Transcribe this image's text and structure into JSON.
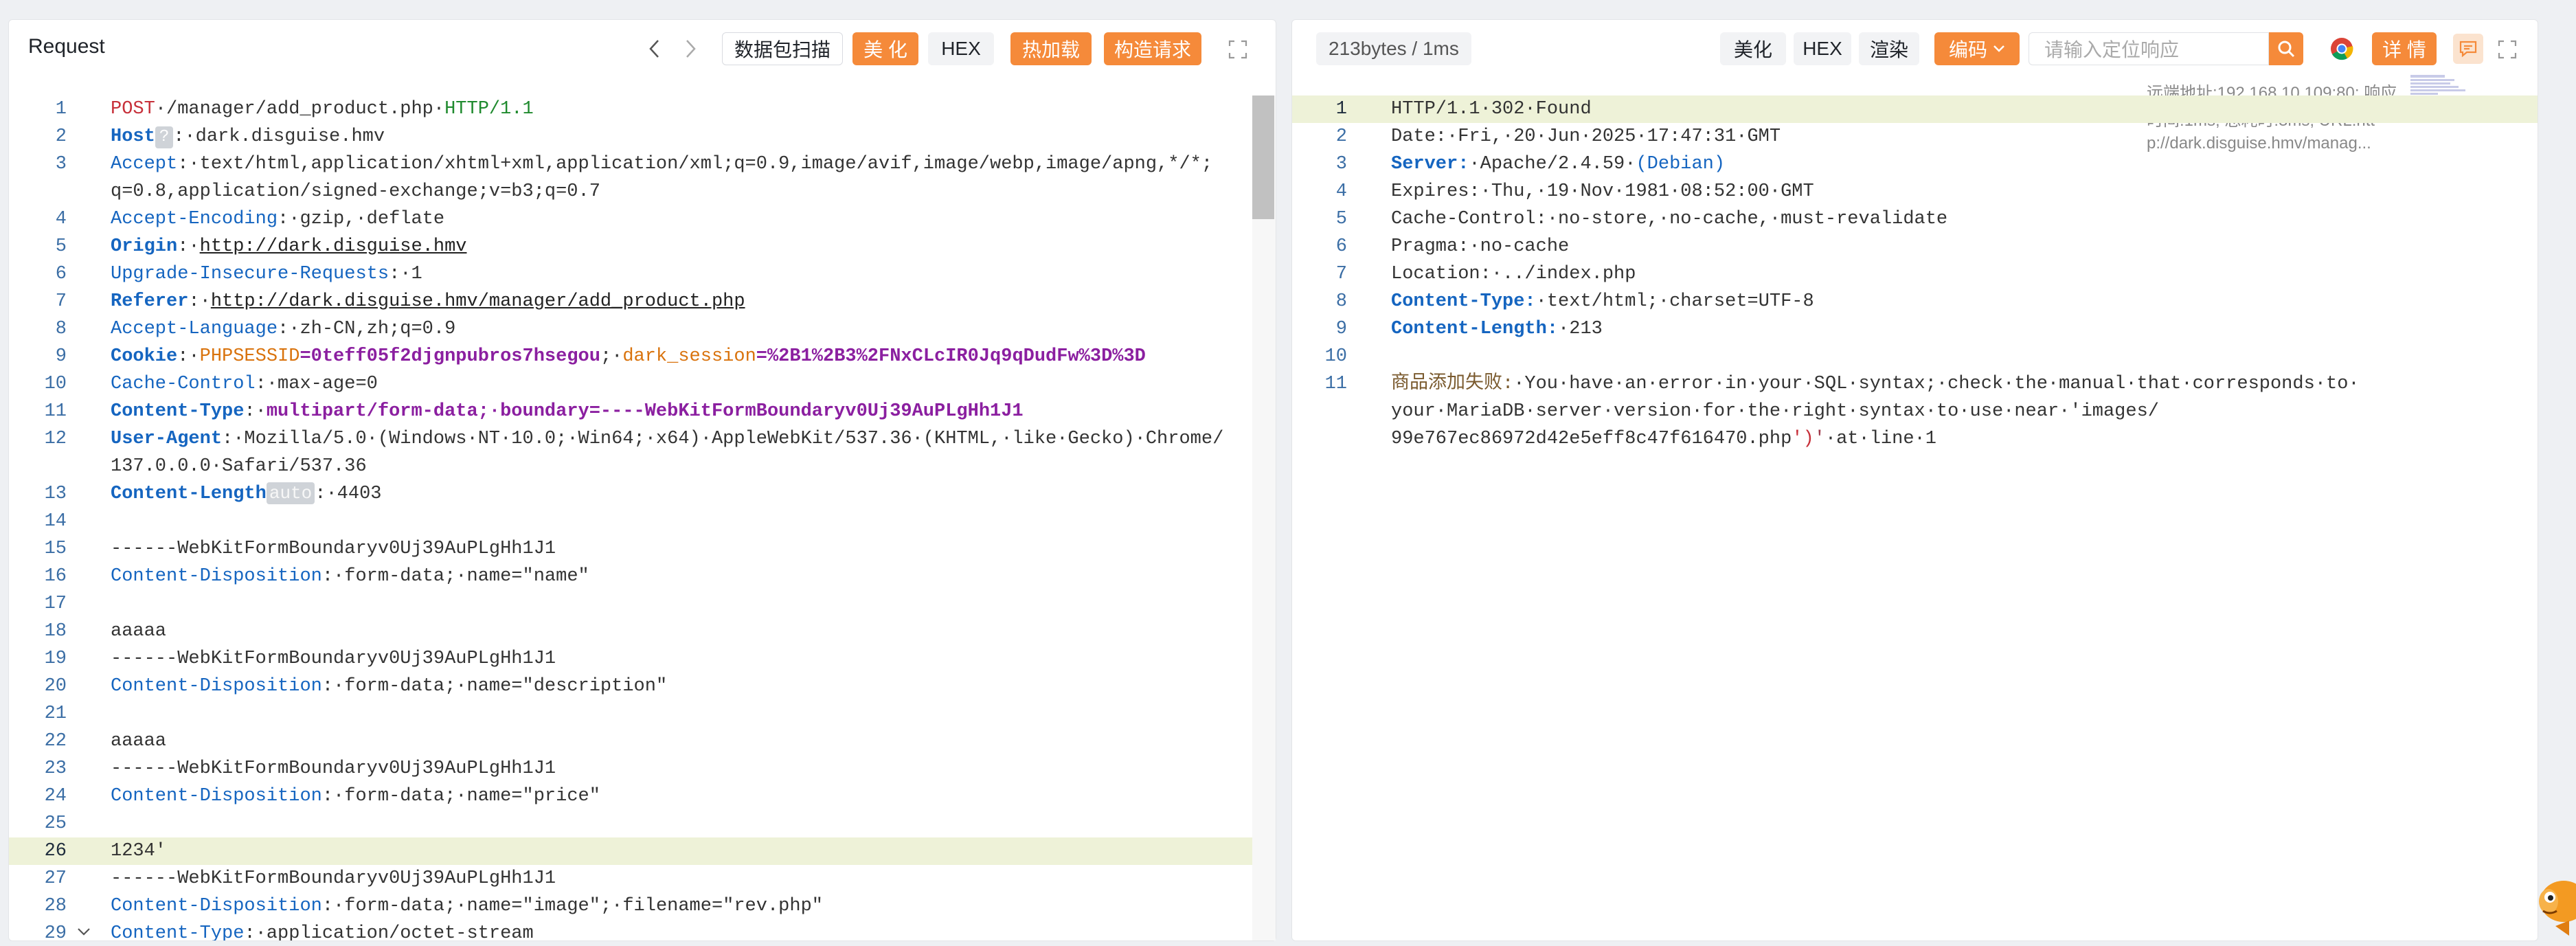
{
  "request": {
    "title": "Request",
    "toolbar": {
      "scan_label": "数据包扫描",
      "beautify_label": "美 化",
      "hex_label": "HEX",
      "hotload_label": "热加载",
      "construct_label": "构造请求"
    },
    "lines": [
      {
        "n": "1",
        "segments": [
          {
            "t": "POST",
            "c": "c-method"
          },
          {
            "t": "·/manager/add_product.php·",
            "c": "c-val"
          },
          {
            "t": "HTTP/1.1",
            "c": "c-proto"
          }
        ]
      },
      {
        "n": "2",
        "segments": [
          {
            "t": "Host",
            "c": "c-bold"
          },
          {
            "t": "?",
            "c": "hostq"
          },
          {
            "t": ":·dark.disguise.hmv",
            "c": "c-val"
          }
        ]
      },
      {
        "n": "3",
        "segments": [
          {
            "t": "Accept",
            "c": "c-key"
          },
          {
            "t": ":·text/html,application/xhtml+xml,application/xml;q=0.9,image/avif,image/webp,image/apng,*/*;",
            "c": "c-val"
          }
        ]
      },
      {
        "n": "",
        "segments": [
          {
            "t": "q=0.8,application/signed-exchange;v=b3;q=0.7",
            "c": "c-val"
          }
        ]
      },
      {
        "n": "4",
        "segments": [
          {
            "t": "Accept-Encoding",
            "c": "c-key"
          },
          {
            "t": ":·gzip,·deflate",
            "c": "c-val"
          }
        ]
      },
      {
        "n": "5",
        "segments": [
          {
            "t": "Origin",
            "c": "c-bold"
          },
          {
            "t": ":·",
            "c": "c-val"
          },
          {
            "t": "http://dark.disguise.hmv",
            "c": "c-link"
          }
        ]
      },
      {
        "n": "6",
        "segments": [
          {
            "t": "Upgrade-Insecure-Requests",
            "c": "c-key"
          },
          {
            "t": ":·1",
            "c": "c-val"
          }
        ]
      },
      {
        "n": "7",
        "segments": [
          {
            "t": "Referer",
            "c": "c-bold"
          },
          {
            "t": ":·",
            "c": "c-val"
          },
          {
            "t": "http://dark.disguise.hmv/manager/add_product.php",
            "c": "c-link"
          }
        ]
      },
      {
        "n": "8",
        "segments": [
          {
            "t": "Accept-Language",
            "c": "c-key"
          },
          {
            "t": ":·zh-CN,zh;q=0.9",
            "c": "c-val"
          }
        ]
      },
      {
        "n": "9",
        "segments": [
          {
            "t": "Cookie",
            "c": "c-bold"
          },
          {
            "t": ":·",
            "c": "c-val"
          },
          {
            "t": "PHPSESSID",
            "c": "c-cookiename"
          },
          {
            "t": "=0teff05f2djgnpubros7hsegou",
            "c": "c-cookieval"
          },
          {
            "t": ";·",
            "c": "c-val"
          },
          {
            "t": "dark_session",
            "c": "c-cookiename"
          },
          {
            "t": "=%2B1%2B3%2FNxCLcIR0Jq9qDudFw%3D%3D",
            "c": "c-cookieval"
          }
        ]
      },
      {
        "n": "10",
        "segments": [
          {
            "t": "Cache-Control",
            "c": "c-key"
          },
          {
            "t": ":·max-age=0",
            "c": "c-val"
          }
        ]
      },
      {
        "n": "11",
        "segments": [
          {
            "t": "Content-Type",
            "c": "c-bold"
          },
          {
            "t": ":·",
            "c": "c-val"
          },
          {
            "t": "multipart/form-data;·boundary=----WebKitFormBoundaryv0Uj39AuPLgHh1J1",
            "c": "c-ct"
          }
        ]
      },
      {
        "n": "12",
        "segments": [
          {
            "t": "User-Agent",
            "c": "c-bold"
          },
          {
            "t": ":·Mozilla/5.0·(Windows·NT·10.0;·Win64;·x64)·AppleWebKit/537.36·(KHTML,·like·Gecko)·Chrome/",
            "c": "c-val"
          }
        ]
      },
      {
        "n": "",
        "segments": [
          {
            "t": "137.0.0.0·Safari/537.36",
            "c": "c-val"
          }
        ]
      },
      {
        "n": "13",
        "segments": [
          {
            "t": "Content-Length",
            "c": "c-bold"
          },
          {
            "t": "auto",
            "c": "autotag"
          },
          {
            "t": ":·4403",
            "c": "c-val"
          }
        ]
      },
      {
        "n": "14",
        "segments": []
      },
      {
        "n": "15",
        "segments": [
          {
            "t": "------WebKitFormBoundaryv0Uj39AuPLgHh1J1",
            "c": "c-val"
          }
        ]
      },
      {
        "n": "16",
        "segments": [
          {
            "t": "Content-Disposition",
            "c": "c-key"
          },
          {
            "t": ":·form-data;·name=\"name\"",
            "c": "c-val"
          }
        ]
      },
      {
        "n": "17",
        "segments": []
      },
      {
        "n": "18",
        "segments": [
          {
            "t": "aaaaa",
            "c": "c-val"
          }
        ]
      },
      {
        "n": "19",
        "segments": [
          {
            "t": "------WebKitFormBoundaryv0Uj39AuPLgHh1J1",
            "c": "c-val"
          }
        ]
      },
      {
        "n": "20",
        "segments": [
          {
            "t": "Content-Disposition",
            "c": "c-key"
          },
          {
            "t": ":·form-data;·name=\"description\"",
            "c": "c-val"
          }
        ]
      },
      {
        "n": "21",
        "segments": []
      },
      {
        "n": "22",
        "segments": [
          {
            "t": "aaaaa",
            "c": "c-val"
          }
        ]
      },
      {
        "n": "23",
        "segments": [
          {
            "t": "------WebKitFormBoundaryv0Uj39AuPLgHh1J1",
            "c": "c-val"
          }
        ]
      },
      {
        "n": "24",
        "segments": [
          {
            "t": "Content-Disposition",
            "c": "c-key"
          },
          {
            "t": ":·form-data;·name=\"price\"",
            "c": "c-val"
          }
        ]
      },
      {
        "n": "25",
        "segments": []
      },
      {
        "n": "26",
        "hl": true,
        "segments": [
          {
            "t": "1234'",
            "c": "c-val"
          }
        ]
      },
      {
        "n": "27",
        "segments": [
          {
            "t": "------WebKitFormBoundaryv0Uj39AuPLgHh1J1",
            "c": "c-val"
          }
        ]
      },
      {
        "n": "28",
        "segments": [
          {
            "t": "Content-Disposition",
            "c": "c-key"
          },
          {
            "t": ":·form-data;·name=\"image\";·filename=\"rev.php\"",
            "c": "c-val"
          }
        ]
      },
      {
        "n": "29",
        "fold": true,
        "segments": [
          {
            "t": "Content-Type",
            "c": "c-key"
          },
          {
            "t": ":·application/octet-stream",
            "c": "c-val"
          }
        ]
      }
    ]
  },
  "response": {
    "size_badge": "213bytes / 1ms",
    "toolbar": {
      "beautify_label": "美化",
      "hex_label": "HEX",
      "render_label": "渲染",
      "encode_label": "编码",
      "search_placeholder": "请输入定位响应",
      "detail_label": "详 情"
    },
    "meta": {
      "remote": "远端地址:192.168.10.109:80;  响应",
      "timing": "时间:1ms;  总耗时:3ms;  URL:htt",
      "url": "p://dark.disguise.hmv/manag..."
    },
    "lines": [
      {
        "n": "1",
        "hl": true,
        "segments": [
          {
            "t": "HTTP/1.1·302·Found",
            "c": "c-val"
          }
        ]
      },
      {
        "n": "2",
        "segments": [
          {
            "t": "Date:·Fri,·20·Jun·2025·17:47:31·GMT",
            "c": "c-val"
          }
        ]
      },
      {
        "n": "3",
        "segments": [
          {
            "t": "Server:",
            "c": "c-bold"
          },
          {
            "t": "·Apache/2.4.59·",
            "c": "c-val"
          },
          {
            "t": "(Debian)",
            "c": "c-paren"
          }
        ]
      },
      {
        "n": "4",
        "segments": [
          {
            "t": "Expires:·Thu,·19·Nov·1981·08:52:00·GMT",
            "c": "c-val"
          }
        ]
      },
      {
        "n": "5",
        "segments": [
          {
            "t": "Cache-Control:·no-store,·no-cache,·must-revalidate",
            "c": "c-val"
          }
        ]
      },
      {
        "n": "6",
        "segments": [
          {
            "t": "Pragma:·no-cache",
            "c": "c-val"
          }
        ]
      },
      {
        "n": "7",
        "segments": [
          {
            "t": "Location:·../index.php",
            "c": "c-val"
          }
        ]
      },
      {
        "n": "8",
        "segments": [
          {
            "t": "Content-Type:",
            "c": "c-bold"
          },
          {
            "t": "·text/html;·charset=UTF-8",
            "c": "c-val"
          }
        ]
      },
      {
        "n": "9",
        "segments": [
          {
            "t": "Content-Length:",
            "c": "c-bold"
          },
          {
            "t": "·213",
            "c": "c-val"
          }
        ]
      },
      {
        "n": "10",
        "segments": []
      },
      {
        "n": "11",
        "segments": [
          {
            "t": "商品添加失败:",
            "c": "c-cn"
          },
          {
            "t": "·You·have·an·error·in·your·SQL·syntax;·check·the·manual·that·corresponds·to·",
            "c": "c-val"
          }
        ]
      },
      {
        "n": "",
        "segments": [
          {
            "t": "your·MariaDB·server·version·for·the·right·syntax·to·use·near·'images/",
            "c": "c-val"
          }
        ]
      },
      {
        "n": "",
        "segments": [
          {
            "t": "99e767ec86972d42e5eff8c47f616470.php",
            "c": "c-val"
          },
          {
            "t": "')",
            "c": "c-err"
          },
          {
            "t": "'",
            "c": "c-str"
          },
          {
            "t": "·at·line·1",
            "c": "c-val"
          }
        ]
      }
    ]
  },
  "colors": {
    "accent": "#f58a3a",
    "highlight": "#eef2d8",
    "key": "#1565c0"
  },
  "icons": [
    "chevron-left-icon",
    "chevron-right-icon",
    "expand-icon",
    "search-icon",
    "chrome-icon",
    "comment-icon",
    "mascot-icon"
  ]
}
